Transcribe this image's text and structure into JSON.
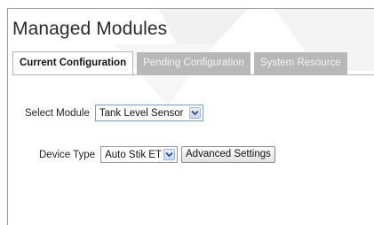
{
  "page": {
    "title": "Managed Modules"
  },
  "tabs": [
    {
      "label": "Current Configuration",
      "active": true
    },
    {
      "label": "Pending Configuration",
      "active": false
    },
    {
      "label": "System Resource",
      "active": false
    }
  ],
  "module_select": {
    "label": "Select Module",
    "value": "Tank Level Sensor"
  },
  "device_type": {
    "label": "Device Type",
    "value": "Auto Stik ET"
  },
  "advanced_button": {
    "label": "Advanced Settings"
  },
  "colors": {
    "inactive_tab": "#b8b8b8",
    "active_tab": "#ffffff",
    "dropdown_arrow": "#2c4a8a"
  },
  "icons": {
    "dropdown": "chevron-down-icon"
  }
}
